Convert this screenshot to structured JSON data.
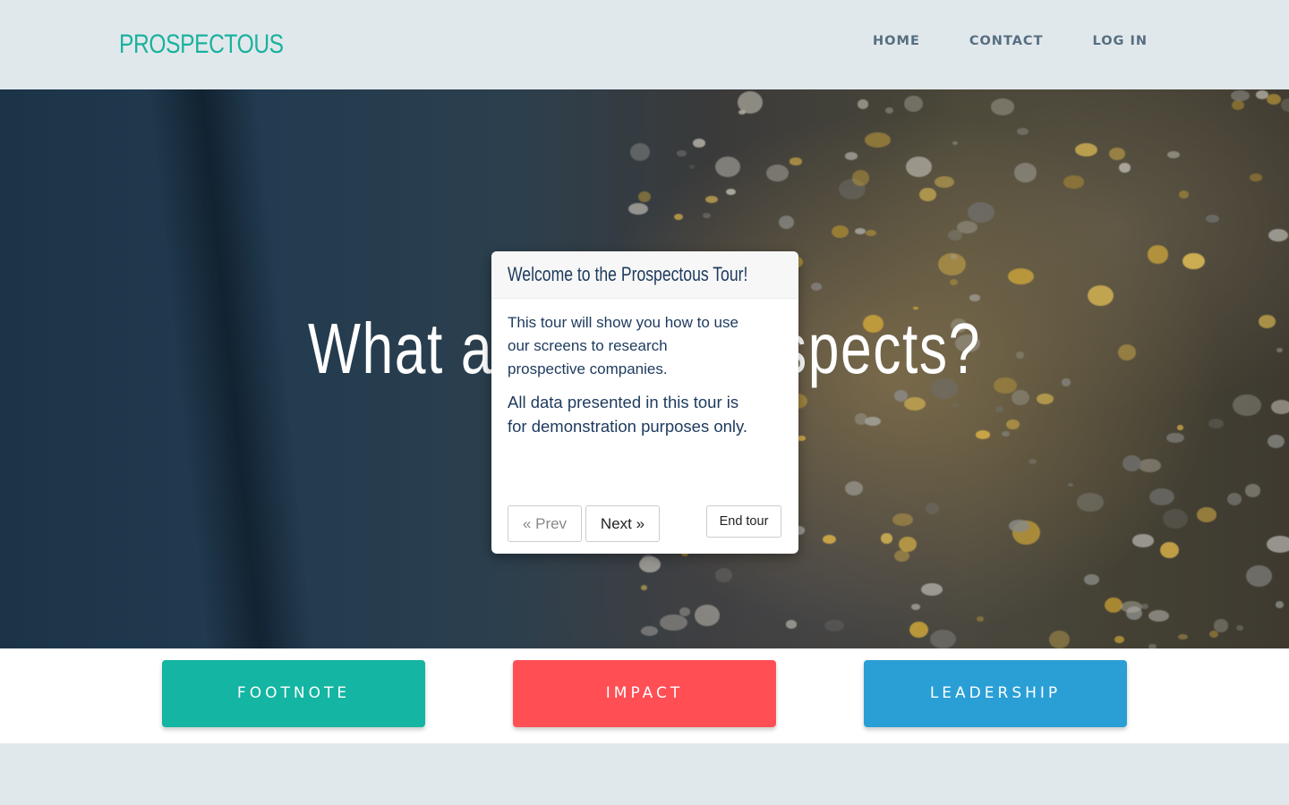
{
  "header": {
    "logo": "PROSPECTOUS",
    "nav": [
      {
        "label": "HOME"
      },
      {
        "label": "CONTACT"
      },
      {
        "label": "LOG IN"
      }
    ]
  },
  "hero": {
    "title": "What are your prospects?"
  },
  "tour": {
    "title": "Welcome to the Prospectous Tour!",
    "paragraph_1": "This tour will show you how to use our screens to research prospective companies.",
    "paragraph_2": "All data presented in this tour is for demonstration purposes only.",
    "prev_label": "« Prev",
    "next_label": "Next »",
    "end_label": "End tour"
  },
  "categories": [
    {
      "label": "FOOTNOTE",
      "color": "#14b5a2"
    },
    {
      "label": "IMPACT",
      "color": "#ff4f55"
    },
    {
      "label": "LEADERSHIP",
      "color": "#299fd6"
    }
  ],
  "colors": {
    "brand": "#1ab29e",
    "nav_text": "#566e80",
    "header_bg": "#e1e8ec",
    "tour_text": "#1d3a5e"
  }
}
